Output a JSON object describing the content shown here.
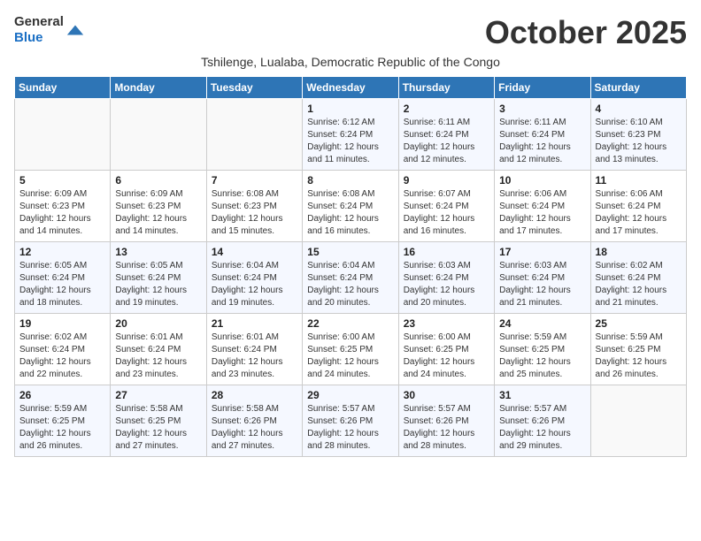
{
  "header": {
    "logo_line1": "General",
    "logo_line2": "Blue",
    "month_title": "October 2025",
    "subtitle": "Tshilenge, Lualaba, Democratic Republic of the Congo"
  },
  "days_of_week": [
    "Sunday",
    "Monday",
    "Tuesday",
    "Wednesday",
    "Thursday",
    "Friday",
    "Saturday"
  ],
  "weeks": [
    [
      {
        "day": "",
        "info": ""
      },
      {
        "day": "",
        "info": ""
      },
      {
        "day": "",
        "info": ""
      },
      {
        "day": "1",
        "info": "Sunrise: 6:12 AM\nSunset: 6:24 PM\nDaylight: 12 hours and 11 minutes."
      },
      {
        "day": "2",
        "info": "Sunrise: 6:11 AM\nSunset: 6:24 PM\nDaylight: 12 hours and 12 minutes."
      },
      {
        "day": "3",
        "info": "Sunrise: 6:11 AM\nSunset: 6:24 PM\nDaylight: 12 hours and 12 minutes."
      },
      {
        "day": "4",
        "info": "Sunrise: 6:10 AM\nSunset: 6:23 PM\nDaylight: 12 hours and 13 minutes."
      }
    ],
    [
      {
        "day": "5",
        "info": "Sunrise: 6:09 AM\nSunset: 6:23 PM\nDaylight: 12 hours and 14 minutes."
      },
      {
        "day": "6",
        "info": "Sunrise: 6:09 AM\nSunset: 6:23 PM\nDaylight: 12 hours and 14 minutes."
      },
      {
        "day": "7",
        "info": "Sunrise: 6:08 AM\nSunset: 6:23 PM\nDaylight: 12 hours and 15 minutes."
      },
      {
        "day": "8",
        "info": "Sunrise: 6:08 AM\nSunset: 6:24 PM\nDaylight: 12 hours and 16 minutes."
      },
      {
        "day": "9",
        "info": "Sunrise: 6:07 AM\nSunset: 6:24 PM\nDaylight: 12 hours and 16 minutes."
      },
      {
        "day": "10",
        "info": "Sunrise: 6:06 AM\nSunset: 6:24 PM\nDaylight: 12 hours and 17 minutes."
      },
      {
        "day": "11",
        "info": "Sunrise: 6:06 AM\nSunset: 6:24 PM\nDaylight: 12 hours and 17 minutes."
      }
    ],
    [
      {
        "day": "12",
        "info": "Sunrise: 6:05 AM\nSunset: 6:24 PM\nDaylight: 12 hours and 18 minutes."
      },
      {
        "day": "13",
        "info": "Sunrise: 6:05 AM\nSunset: 6:24 PM\nDaylight: 12 hours and 19 minutes."
      },
      {
        "day": "14",
        "info": "Sunrise: 6:04 AM\nSunset: 6:24 PM\nDaylight: 12 hours and 19 minutes."
      },
      {
        "day": "15",
        "info": "Sunrise: 6:04 AM\nSunset: 6:24 PM\nDaylight: 12 hours and 20 minutes."
      },
      {
        "day": "16",
        "info": "Sunrise: 6:03 AM\nSunset: 6:24 PM\nDaylight: 12 hours and 20 minutes."
      },
      {
        "day": "17",
        "info": "Sunrise: 6:03 AM\nSunset: 6:24 PM\nDaylight: 12 hours and 21 minutes."
      },
      {
        "day": "18",
        "info": "Sunrise: 6:02 AM\nSunset: 6:24 PM\nDaylight: 12 hours and 21 minutes."
      }
    ],
    [
      {
        "day": "19",
        "info": "Sunrise: 6:02 AM\nSunset: 6:24 PM\nDaylight: 12 hours and 22 minutes."
      },
      {
        "day": "20",
        "info": "Sunrise: 6:01 AM\nSunset: 6:24 PM\nDaylight: 12 hours and 23 minutes."
      },
      {
        "day": "21",
        "info": "Sunrise: 6:01 AM\nSunset: 6:24 PM\nDaylight: 12 hours and 23 minutes."
      },
      {
        "day": "22",
        "info": "Sunrise: 6:00 AM\nSunset: 6:25 PM\nDaylight: 12 hours and 24 minutes."
      },
      {
        "day": "23",
        "info": "Sunrise: 6:00 AM\nSunset: 6:25 PM\nDaylight: 12 hours and 24 minutes."
      },
      {
        "day": "24",
        "info": "Sunrise: 5:59 AM\nSunset: 6:25 PM\nDaylight: 12 hours and 25 minutes."
      },
      {
        "day": "25",
        "info": "Sunrise: 5:59 AM\nSunset: 6:25 PM\nDaylight: 12 hours and 26 minutes."
      }
    ],
    [
      {
        "day": "26",
        "info": "Sunrise: 5:59 AM\nSunset: 6:25 PM\nDaylight: 12 hours and 26 minutes."
      },
      {
        "day": "27",
        "info": "Sunrise: 5:58 AM\nSunset: 6:25 PM\nDaylight: 12 hours and 27 minutes."
      },
      {
        "day": "28",
        "info": "Sunrise: 5:58 AM\nSunset: 6:26 PM\nDaylight: 12 hours and 27 minutes."
      },
      {
        "day": "29",
        "info": "Sunrise: 5:57 AM\nSunset: 6:26 PM\nDaylight: 12 hours and 28 minutes."
      },
      {
        "day": "30",
        "info": "Sunrise: 5:57 AM\nSunset: 6:26 PM\nDaylight: 12 hours and 28 minutes."
      },
      {
        "day": "31",
        "info": "Sunrise: 5:57 AM\nSunset: 6:26 PM\nDaylight: 12 hours and 29 minutes."
      },
      {
        "day": "",
        "info": ""
      }
    ]
  ]
}
